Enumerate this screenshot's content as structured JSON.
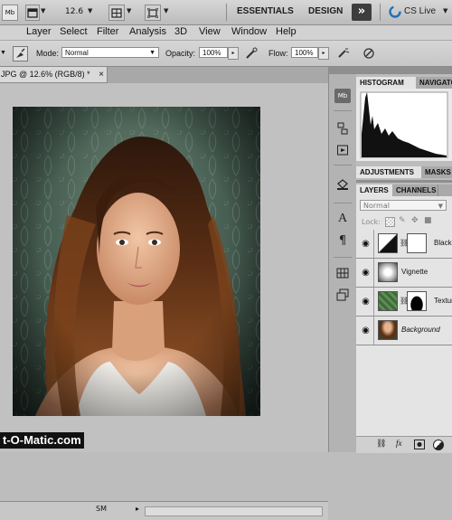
{
  "app_bar": {
    "mb_button": "Mb",
    "zoom_level": "12.6",
    "workspace_essentials": "ESSENTIALS",
    "workspace_design": "DESIGN",
    "more_workspaces": "»",
    "cs_live": "CS Live"
  },
  "menu": [
    "Layer",
    "Select",
    "Filter",
    "Analysis",
    "3D",
    "View",
    "Window",
    "Help"
  ],
  "options": {
    "mode_label": "Mode:",
    "mode_value": "Normal",
    "opacity_label": "Opacity:",
    "opacity_value": "100%",
    "flow_label": "Flow:",
    "flow_value": "100%"
  },
  "document": {
    "tab_title": "JPG @ 12.6% (RGB/8) *",
    "tab_close": "×",
    "status_text": "SM"
  },
  "watermark": "t-O-Matic.com",
  "tools": [
    "mini-bridge",
    "brush-presets",
    "notes",
    "paint-bucket",
    "character",
    "paragraph",
    "histogram-grid",
    "layer-comps"
  ],
  "panels": {
    "histogram_tab": "HISTOGRAM",
    "navigator_tab": "NAVIGATO",
    "adjustments_tab": "ADJUSTMENTS",
    "masks_tab": "MASKS",
    "layers_tab": "LAYERS",
    "channels_tab": "CHANNELS",
    "blend_mode": "Normal",
    "lock_label": "Lock:",
    "layers": [
      {
        "name": "Black",
        "kind": "adjustment"
      },
      {
        "name": "Vignette",
        "kind": "texture"
      },
      {
        "name": "Texture",
        "kind": "masked"
      },
      {
        "name": "Background",
        "kind": "photo"
      }
    ],
    "bottom_icons": [
      "link",
      "fx",
      "mask",
      "adjustment"
    ]
  },
  "colors": {
    "chrome": "#c8c8c8",
    "panel_tab_active": "#e4e4e4",
    "photo_bg": "#4c6458",
    "cs_live": "#1e6fb8"
  }
}
